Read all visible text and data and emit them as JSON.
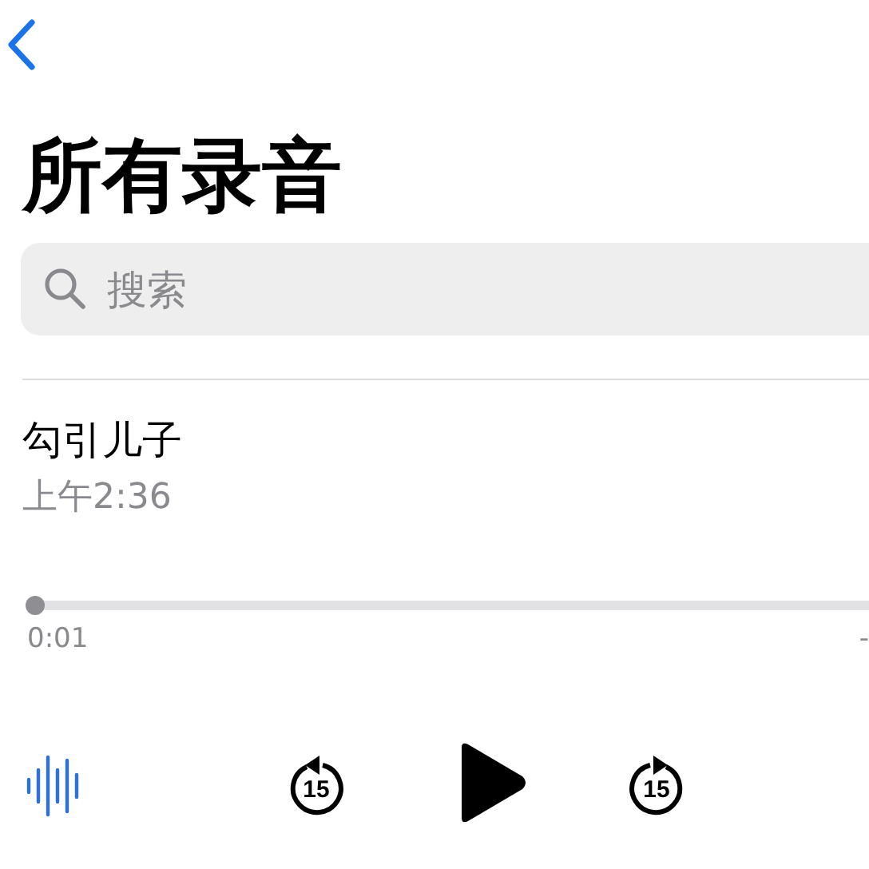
{
  "title": "所有录音",
  "search": {
    "placeholder": "搜索"
  },
  "recording": {
    "name": "勾引儿子",
    "time": "上午2:36"
  },
  "player": {
    "level": 0.0,
    "elapsed": "0:01",
    "remaining": "-"
  },
  "controls": {
    "rewind": "15",
    "forward": "15"
  }
}
